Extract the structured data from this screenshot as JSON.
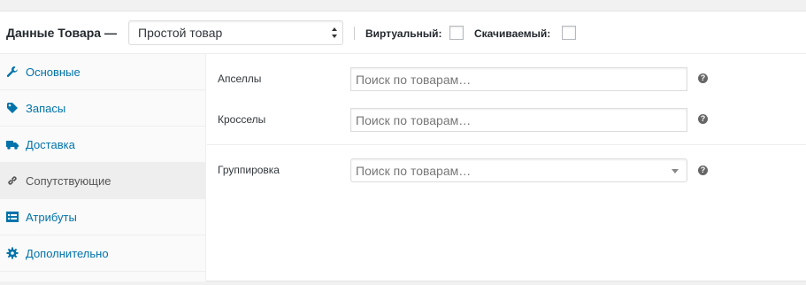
{
  "header": {
    "title": "Данные Товара —",
    "product_type": "Простой товар",
    "virtual_label": "Виртуальный:",
    "downloadable_label": "Скачиваемый:"
  },
  "sidebar": {
    "items": [
      {
        "label": "Основные",
        "icon": "wrench-icon"
      },
      {
        "label": "Запасы",
        "icon": "tag-icon"
      },
      {
        "label": "Доставка",
        "icon": "truck-icon"
      },
      {
        "label": "Сопутствующие",
        "icon": "link-icon",
        "active": true
      },
      {
        "label": "Атрибуты",
        "icon": "list-icon"
      },
      {
        "label": "Дополнительно",
        "icon": "gear-icon"
      }
    ]
  },
  "fields": {
    "upsells": {
      "label": "Апселлы",
      "placeholder": "Поиск по товарам…"
    },
    "crosssells": {
      "label": "Кросселы",
      "placeholder": "Поиск по товарам…"
    },
    "grouping": {
      "label": "Группировка",
      "placeholder": "Поиск по товарам…"
    }
  },
  "help_glyph": "?",
  "colors": {
    "link": "#0073aa",
    "active_tab_bg": "#eeeeee"
  }
}
